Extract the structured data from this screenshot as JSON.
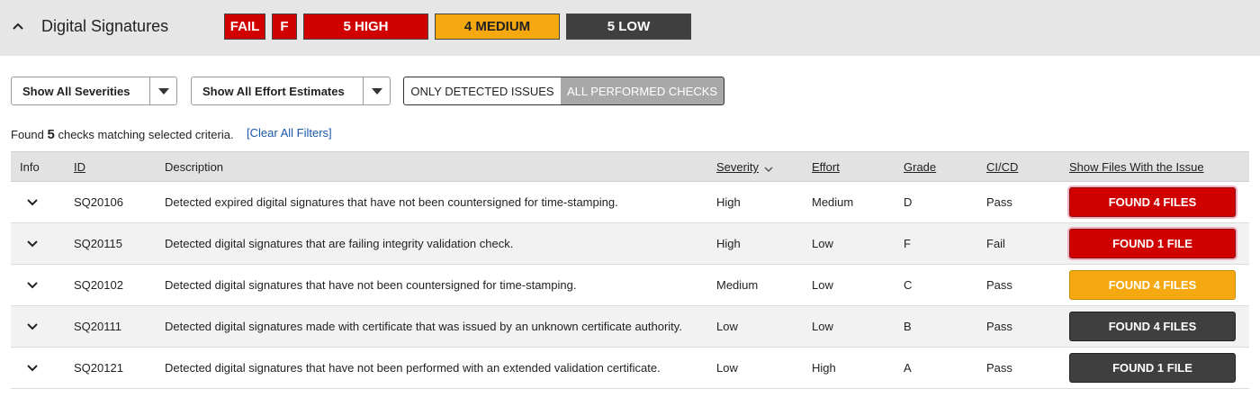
{
  "header": {
    "title": "Digital Signatures",
    "badges": {
      "status": "FAIL",
      "grade": "F",
      "high": "5 HIGH",
      "medium": "4 MEDIUM",
      "low": "5 LOW"
    }
  },
  "filters": {
    "severity_select": "Show All Severities",
    "effort_select": "Show All Effort Estimates",
    "toggle_detected": "ONLY DETECTED ISSUES",
    "toggle_all": "ALL PERFORMED CHECKS"
  },
  "summary": {
    "prefix": "Found",
    "count": "5",
    "suffix": "checks matching selected criteria.",
    "clear_link": "[Clear All Filters]"
  },
  "table": {
    "columns": {
      "info": "Info",
      "id": "ID",
      "description": "Description",
      "severity": "Severity",
      "effort": "Effort",
      "grade": "Grade",
      "cicd": "CI/CD",
      "files": "Show Files With the Issue"
    },
    "rows": [
      {
        "id": "SQ20106",
        "description": "Detected expired digital signatures that have not been countersigned for time-stamping.",
        "severity": "High",
        "effort": "Medium",
        "grade": "D",
        "cicd": "Pass",
        "files": "FOUND 4 FILES"
      },
      {
        "id": "SQ20115",
        "description": "Detected digital signatures that are failing integrity validation check.",
        "severity": "High",
        "effort": "Low",
        "grade": "F",
        "cicd": "Fail",
        "files": "FOUND 1 FILE"
      },
      {
        "id": "SQ20102",
        "description": "Detected digital signatures that have not been countersigned for time-stamping.",
        "severity": "Medium",
        "effort": "Low",
        "grade": "C",
        "cicd": "Pass",
        "files": "FOUND 4 FILES"
      },
      {
        "id": "SQ20111",
        "description": "Detected digital signatures made with certificate that was issued by an unknown certificate authority.",
        "severity": "Low",
        "effort": "Low",
        "grade": "B",
        "cicd": "Pass",
        "files": "FOUND 4 FILES"
      },
      {
        "id": "SQ20121",
        "description": "Detected digital signatures that have not been performed with an extended validation certificate.",
        "severity": "Low",
        "effort": "High",
        "grade": "A",
        "cicd": "Pass",
        "files": "FOUND 1 FILE"
      }
    ]
  },
  "colors": {
    "high": "#d10000",
    "medium": "#f5a80f",
    "low": "#3f3f3f",
    "link": "#1a58a8"
  },
  "icons": {
    "collapse": "chevron-up-icon",
    "dropdown": "caret-down-icon",
    "sort": "chevron-down-icon",
    "expand_row": "chevron-down-icon"
  }
}
